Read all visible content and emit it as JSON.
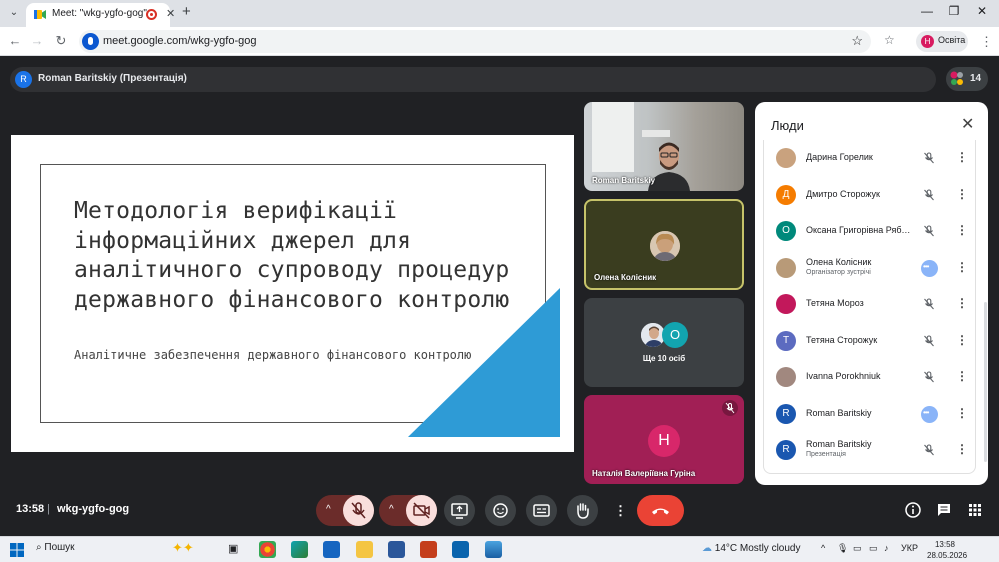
{
  "browser": {
    "tab_title": "Meet: \"wkg-ygfo-gog\"",
    "url": "meet.google.com/wkg-ygfo-gog",
    "profile_initial": "Н",
    "profile_name": "Освіта"
  },
  "meet": {
    "presenter_initial": "R",
    "presenter_label": "Roman Baritskiy (Презентація)",
    "participant_count": "14",
    "clock": "13:58",
    "separator": "|",
    "meeting_code": "wkg-ygfo-gog"
  },
  "slide": {
    "title": "Методологія верифікації інформаційних джерел для аналітичного супроводу процедур державного фінансового контролю",
    "subtitle": "Аналітичне забезпечення державного фінансового контролю",
    "accent_color": "#2e9bd6"
  },
  "tiles": [
    {
      "label": "Roman Baritskiy"
    },
    {
      "label": "Олена Колісник"
    },
    {
      "label": "Ще 10 осіб",
      "second_avatar_initial": "О"
    },
    {
      "label": "Наталія Валеріївна Гуріна",
      "avatar_initial": "Н"
    }
  ],
  "panel": {
    "title": "Люди",
    "people": [
      {
        "name": "Дарина Горелик",
        "initial": "",
        "color": "#c9a27e",
        "role": "",
        "state": "muted"
      },
      {
        "name": "Дмитро Сторожук",
        "initial": "Д",
        "color": "#f57c00",
        "role": "",
        "state": "muted"
      },
      {
        "name": "Оксана Григорівна Рябенко",
        "initial": "О",
        "color": "#00897b",
        "role": "",
        "state": "muted"
      },
      {
        "name": "Олена Колісник",
        "initial": "",
        "color": "#b89a78",
        "role": "Організатор зустрічі",
        "state": "active"
      },
      {
        "name": "Тетяна Мороз",
        "initial": "",
        "color": "#c2185b",
        "role": "",
        "state": "muted"
      },
      {
        "name": "Тетяна Сторожук",
        "initial": "Т",
        "color": "#5c6bc0",
        "role": "",
        "state": "muted"
      },
      {
        "name": "Ivanna Porokhniuk",
        "initial": "",
        "color": "#a1887f",
        "role": "",
        "state": "muted"
      },
      {
        "name": "Roman Baritskiy",
        "initial": "R",
        "color": "#1a57b0",
        "role": "",
        "state": "active"
      },
      {
        "name": "Roman Baritskiy",
        "initial": "R",
        "color": "#1a57b0",
        "role": "Презентація",
        "state": "muted"
      }
    ]
  },
  "taskbar": {
    "search_label": "Пошук",
    "weather": "14°C  Mostly cloudy",
    "lang": "УКР",
    "time": "13:58",
    "date": "28.05.2026"
  }
}
